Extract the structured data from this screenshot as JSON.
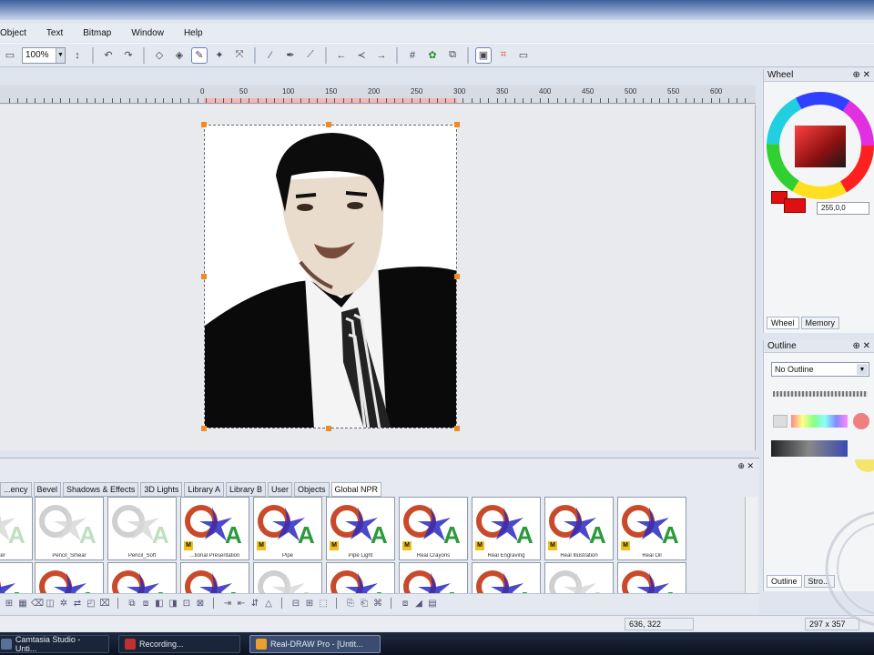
{
  "menu": [
    "Object",
    "Text",
    "Bitmap",
    "Window",
    "Help"
  ],
  "toolbar": {
    "zoom": "100%"
  },
  "ruler": {
    "labels": [
      "50",
      "100",
      "150",
      "200",
      "250",
      "300",
      "350",
      "400",
      "450",
      "500",
      "550",
      "600"
    ],
    "origin": "0"
  },
  "wheel_panel": {
    "title": "Wheel",
    "value": "255,0,0",
    "tabs": [
      "Wheel",
      "Memory"
    ]
  },
  "outline_panel": {
    "title": "Outline",
    "select": "No Outline",
    "tabs": [
      "Outline",
      "Stro..."
    ]
  },
  "library": {
    "tabs": [
      "...ency",
      "Bevel",
      "Shadows & Effects",
      "3D Lights",
      "Library A",
      "Library B",
      "User",
      "Objects",
      "Global NPR"
    ],
    "active_tab": "Global NPR",
    "thumbs_row1": [
      "Water",
      "Pencil_Smear",
      "Pencil_Soft",
      "...tional Presentation",
      "Pipe",
      "Pipe Light",
      "Real Crayons",
      "Real Engraving",
      "Real Illustration",
      "Real Oil"
    ]
  },
  "status": {
    "coords": "636, 322",
    "size": "297 x 357"
  },
  "taskbar": [
    "Camtasia Studio - Unti...",
    "Recording...",
    "Real-DRAW Pro - [Untit..."
  ],
  "colors": {
    "accent": "#3c5f9c",
    "selection_handle": "#f08a24",
    "red_swatch": "#e01010"
  }
}
